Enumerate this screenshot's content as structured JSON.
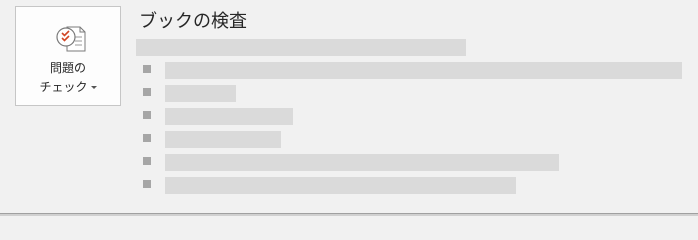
{
  "check_button": {
    "label_line1": "問題の",
    "label_line2": "チェック",
    "icon": "checklist-icon",
    "has_dropdown": true
  },
  "section": {
    "title": "ブックの検査"
  },
  "colors": {
    "background": "#f1f1f1",
    "placeholder": "#dadada",
    "icon_accent": "#d24726",
    "bullet": "#a6a6a6"
  }
}
